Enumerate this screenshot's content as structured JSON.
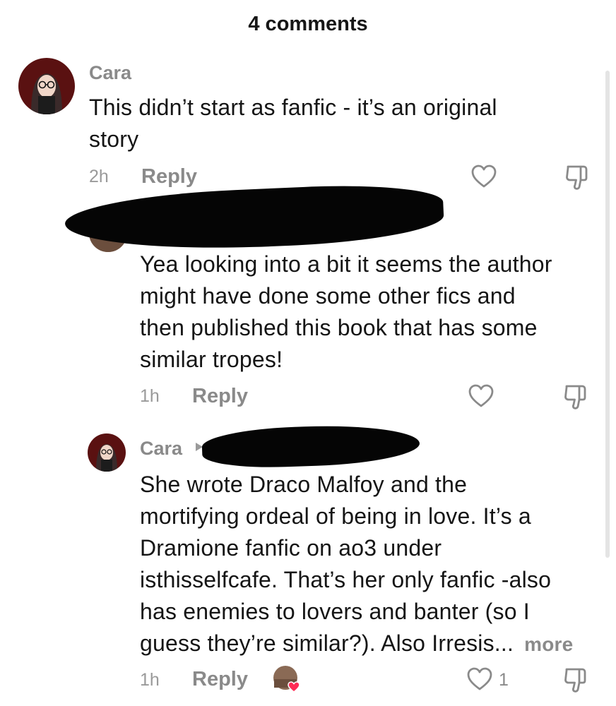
{
  "header": {
    "title": "4 comments"
  },
  "comments": [
    {
      "username": "Cara",
      "text_lines": [
        "This didn’t start as fanfic - it’s an original",
        "story"
      ],
      "time": "2h",
      "reply_label": "Reply"
    },
    {
      "username": "",
      "text_lines": [
        "Yea looking into a bit it seems the author",
        "might have done some other fics and",
        "then published this book that has some",
        "similar tropes!"
      ],
      "time": "1h",
      "reply_label": "Reply"
    },
    {
      "username": "Cara",
      "text_lines": [
        "She wrote Draco Malfoy and the",
        "mortifying ordeal of being in love. It’s a",
        "Dramione fanfic on ao3 under",
        "isthisselfcafe. That’s her only fanfic -also",
        "has enemies to lovers and banter (so I",
        "guess they’re similar?). Also Irresis..."
      ],
      "more_label": "more",
      "time": "1h",
      "reply_label": "Reply",
      "like_count": "1"
    }
  ],
  "icons": {
    "like": "heart-icon",
    "dislike": "thumbs-down-icon",
    "reply_arrow": "play-arrow-icon",
    "creator_liked": "heart-badge-icon"
  },
  "colors": {
    "text": "#151515",
    "secondary": "#8a8a8a",
    "heart_badge": "#fe2c55",
    "redaction": "#050505"
  }
}
